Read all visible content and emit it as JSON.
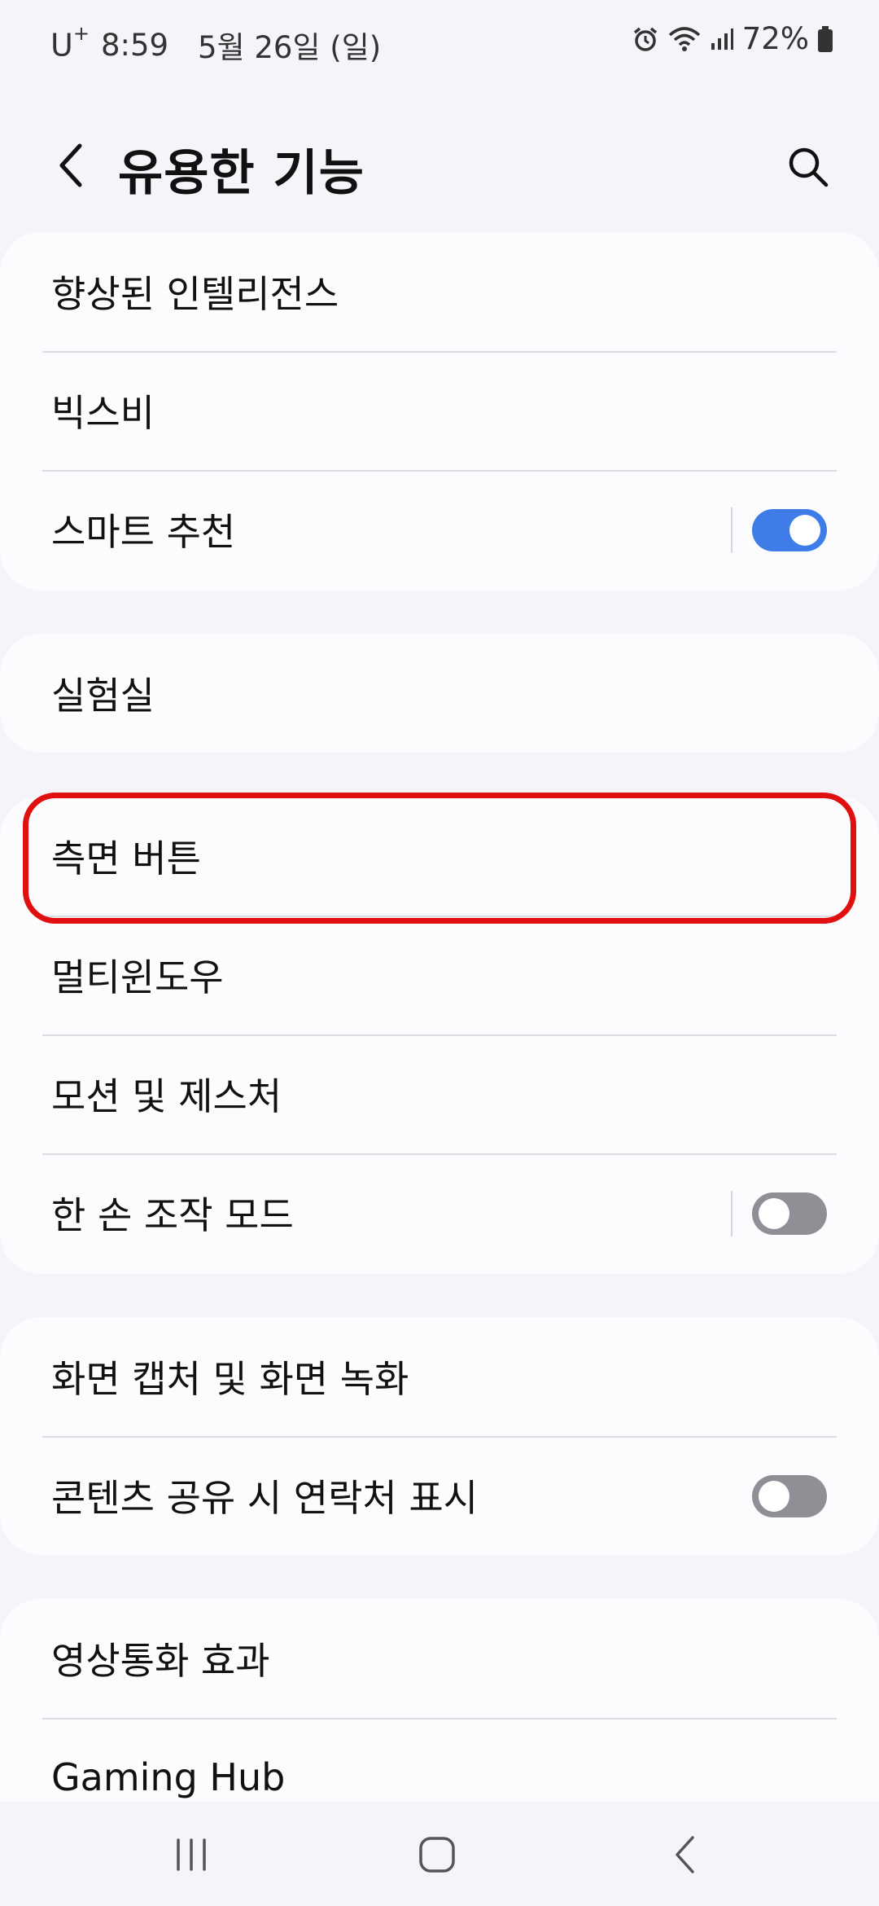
{
  "status_bar": {
    "carrier": "U",
    "carrier_sup": "+",
    "time": "8:59",
    "date": "5월 26일 (일)",
    "battery": "72%"
  },
  "header": {
    "title": "유용한 기능"
  },
  "groups": [
    {
      "items": [
        {
          "label": "향상된 인텔리전스"
        },
        {
          "label": "빅스비"
        },
        {
          "label": "스마트 추천",
          "toggle": "on"
        }
      ]
    },
    {
      "items": [
        {
          "label": "실험실"
        }
      ]
    },
    {
      "items": [
        {
          "label": "측면 버튼"
        },
        {
          "label": "멀티윈도우"
        },
        {
          "label": "모션 및 제스처"
        },
        {
          "label": "한 손 조작 모드",
          "toggle": "off"
        }
      ]
    },
    {
      "items": [
        {
          "label": "화면 캡처 및 화면 녹화"
        },
        {
          "label": "콘텐츠 공유 시 연락처 표시",
          "toggle": "off"
        }
      ]
    },
    {
      "items": [
        {
          "label": "영상통화 효과"
        },
        {
          "label": "Gaming Hub"
        }
      ]
    }
  ],
  "colors": {
    "toggle_on": "#3e7ce8",
    "toggle_off": "#8f8f96",
    "highlight": "#e01010"
  }
}
